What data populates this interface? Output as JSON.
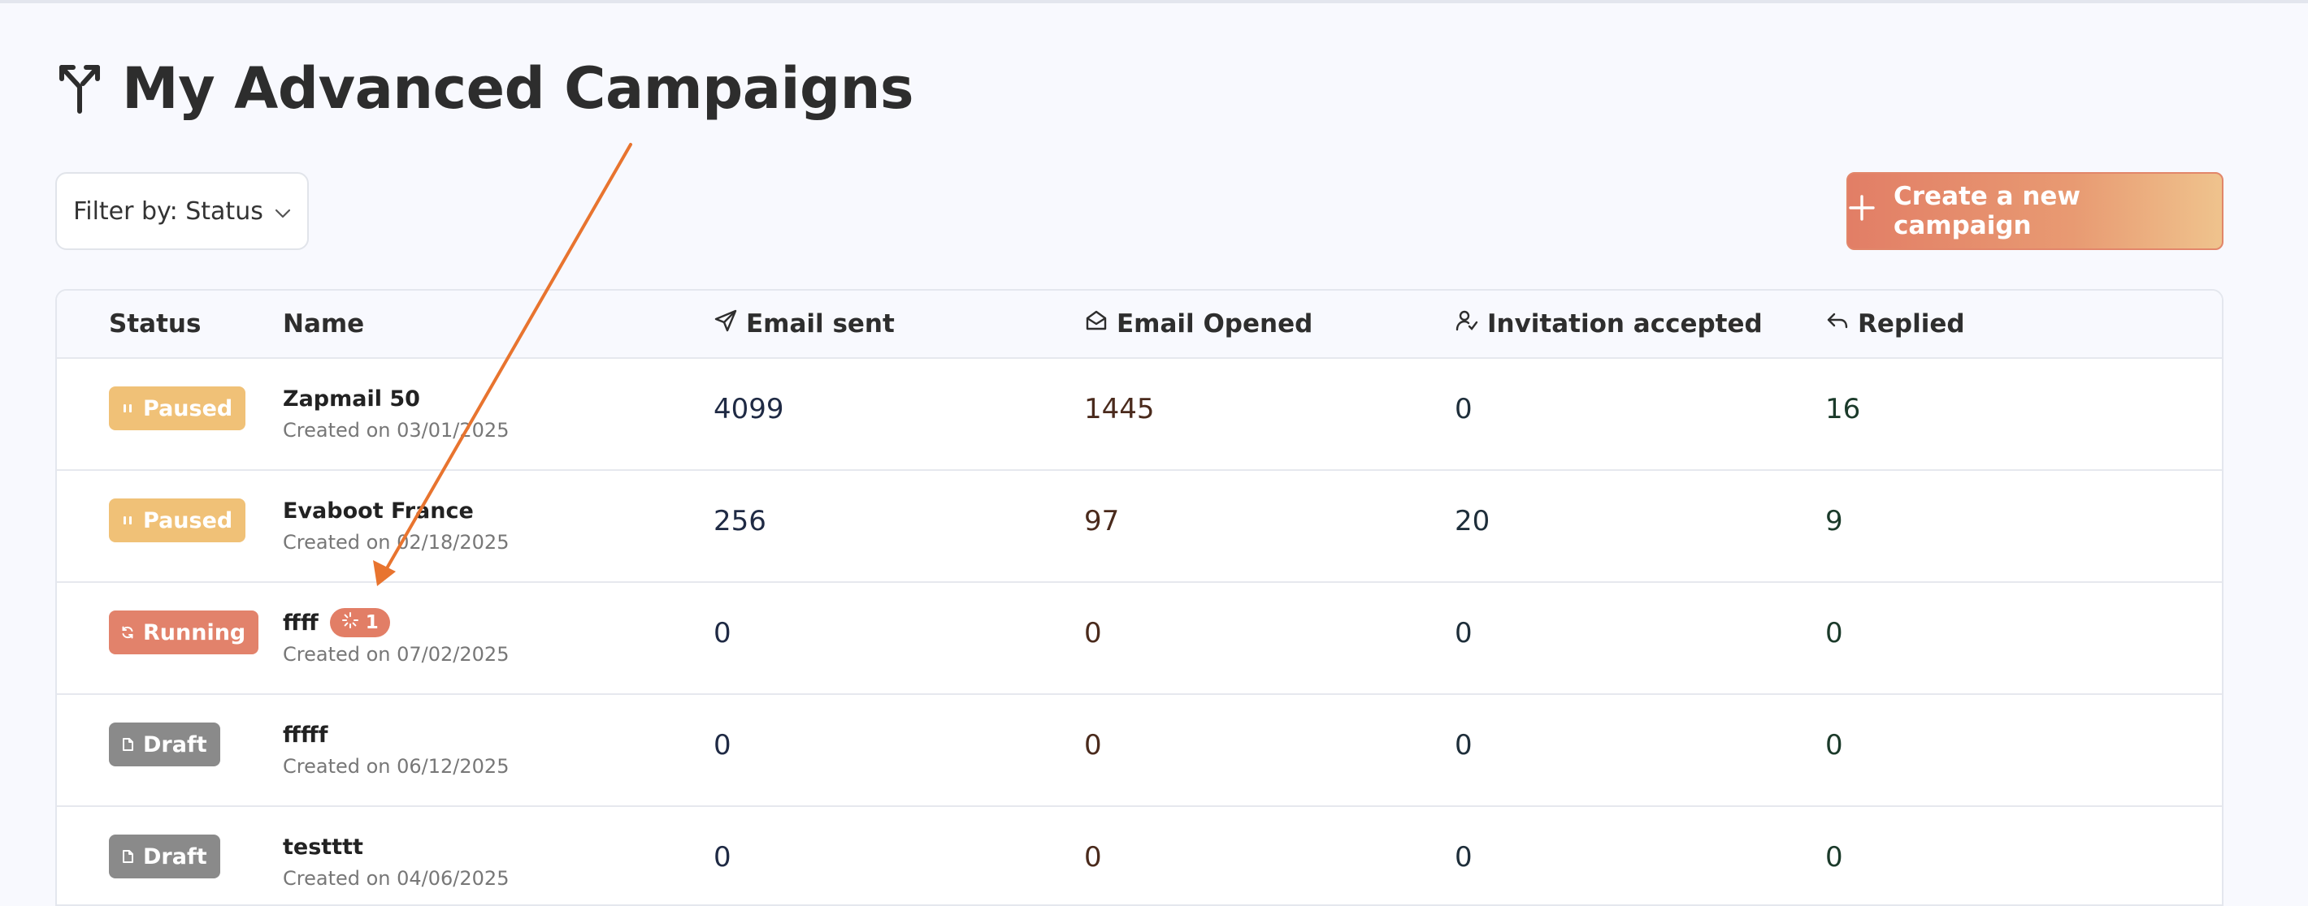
{
  "header": {
    "title": "My Advanced Campaigns",
    "title_icon": "split-arrow-icon"
  },
  "toolbar": {
    "filter_label": "Filter by: Status",
    "create_label": "Create a new campaign"
  },
  "table": {
    "columns": {
      "status": "Status",
      "name": "Name",
      "email_sent": "Email sent",
      "email_opened": "Email Opened",
      "invitation_accepted": "Invitation accepted",
      "replied": "Replied"
    },
    "rows": [
      {
        "status": "Paused",
        "name": "Zapmail 50",
        "created": "Created on 03/01/2025",
        "email_sent": "4099",
        "email_opened": "1445",
        "invitation_accepted": "0",
        "replied": "16"
      },
      {
        "status": "Paused",
        "name": "Evaboot France",
        "created": "Created on 02/18/2025",
        "email_sent": "256",
        "email_opened": "97",
        "invitation_accepted": "20",
        "replied": "9"
      },
      {
        "status": "Running",
        "name": "ffff",
        "step_count": "1",
        "created": "Created on 07/02/2025",
        "email_sent": "0",
        "email_opened": "0",
        "invitation_accepted": "0",
        "replied": "0"
      },
      {
        "status": "Draft",
        "name": "fffff",
        "created": "Created on 06/12/2025",
        "email_sent": "0",
        "email_opened": "0",
        "invitation_accepted": "0",
        "replied": "0"
      },
      {
        "status": "Draft",
        "name": "testttt",
        "created": "Created on 04/06/2025",
        "email_sent": "0",
        "email_opened": "0",
        "invitation_accepted": "0",
        "replied": "0"
      }
    ]
  },
  "colors": {
    "accent": "#e27e66",
    "paused": "#f0c177",
    "running": "#e2826b",
    "draft": "#8a8a8a",
    "annotation_arrow": "#e8742f"
  }
}
